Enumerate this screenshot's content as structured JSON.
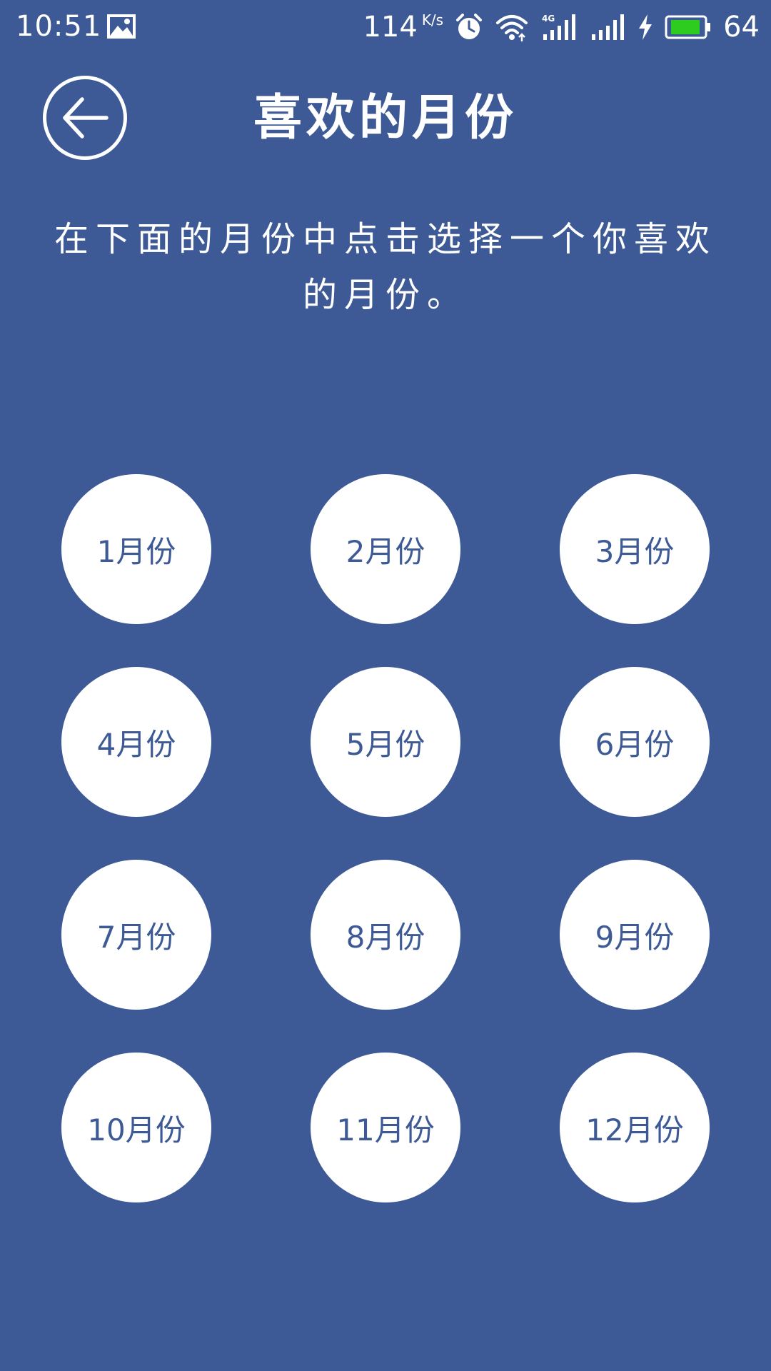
{
  "status_bar": {
    "time": "10:51",
    "net_speed": "114",
    "net_speed_unit": "K/s",
    "battery_level": "64",
    "battery_color": "#2ecc1e",
    "icons": [
      "image-icon",
      "alarm-icon",
      "wifi-icon",
      "signal-4g-icon",
      "signal-icon",
      "charging-icon",
      "battery-icon"
    ]
  },
  "header": {
    "back_icon": "back-arrow-icon",
    "title": "喜欢的月份"
  },
  "instruction": "在下面的月份中点击选择一个你喜欢的月份。",
  "months": [
    {
      "label": "1月份"
    },
    {
      "label": "2月份"
    },
    {
      "label": "3月份"
    },
    {
      "label": "4月份"
    },
    {
      "label": "5月份"
    },
    {
      "label": "6月份"
    },
    {
      "label": "7月份"
    },
    {
      "label": "8月份"
    },
    {
      "label": "9月份"
    },
    {
      "label": "10月份"
    },
    {
      "label": "11月份"
    },
    {
      "label": "12月份"
    }
  ],
  "colors": {
    "background": "#3d5a96",
    "button_bg": "#ffffff",
    "button_text": "#3d5a96"
  }
}
